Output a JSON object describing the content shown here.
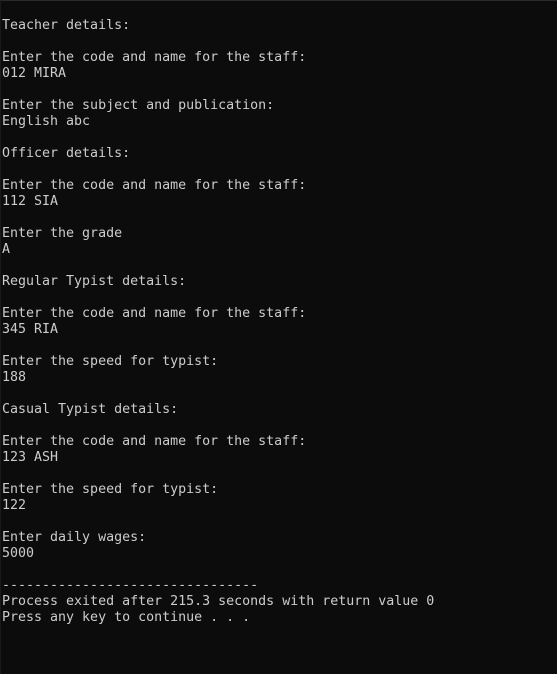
{
  "console": {
    "lines": [
      "Teacher details:",
      "",
      "Enter the code and name for the staff:",
      "012 MIRA",
      "",
      "Enter the subject and publication:",
      "English abc",
      "",
      "Officer details:",
      "",
      "Enter the code and name for the staff:",
      "112 SIA",
      "",
      "Enter the grade",
      "A",
      "",
      "Regular Typist details:",
      "",
      "Enter the code and name for the staff:",
      "345 RIA",
      "",
      "Enter the speed for typist:",
      "188",
      "",
      "Casual Typist details:",
      "",
      "Enter the code and name for the staff:",
      "123 ASH",
      "",
      "Enter the speed for typist:",
      "122",
      "",
      "Enter daily wages:",
      "5000",
      "",
      "--------------------------------",
      "Process exited after 215.3 seconds with return value 0",
      "Press any key to continue . . ."
    ]
  },
  "colors": {
    "background": "#0c0c0c",
    "text": "#cccccc"
  }
}
